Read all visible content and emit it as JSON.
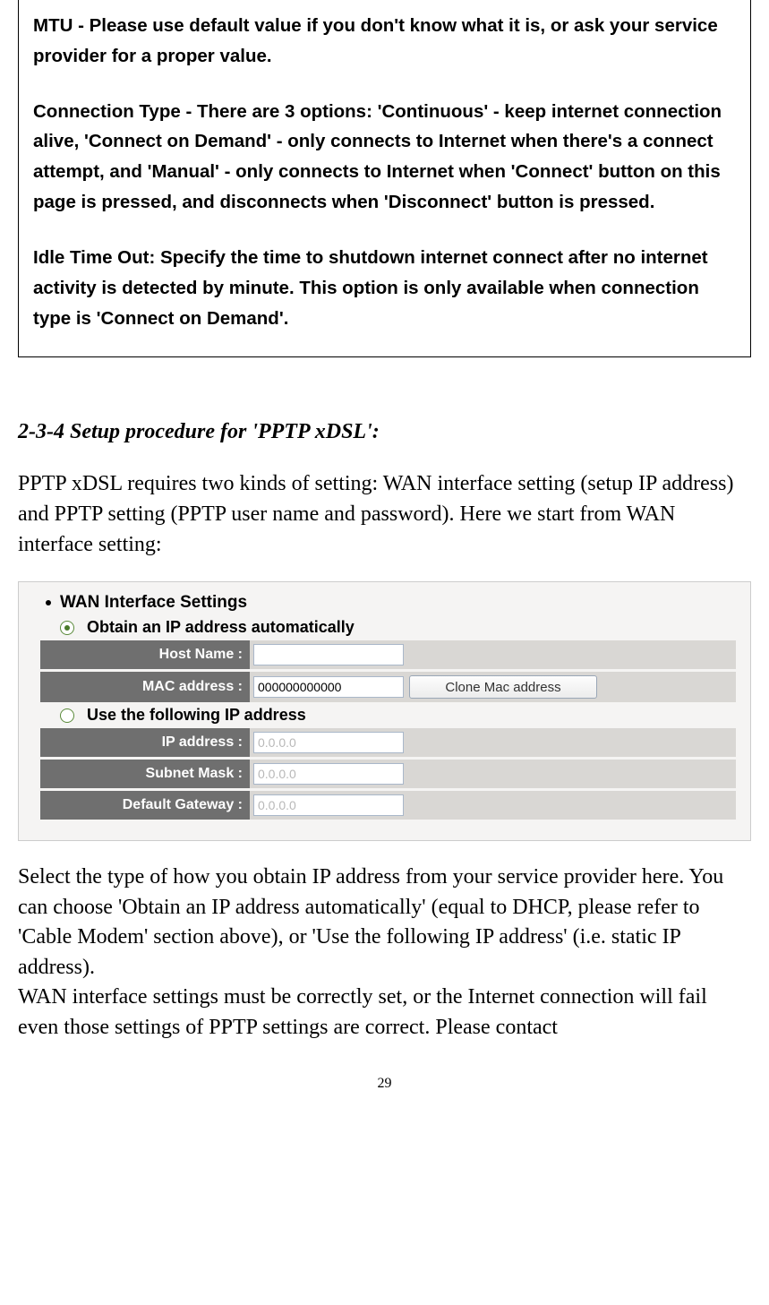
{
  "info_box": {
    "p1": "MTU - Please use default value if you don't know what it is, or ask your service provider for a proper value.",
    "p2": "Connection Type - There are 3 options: 'Continuous' - keep internet connection alive, 'Connect on Demand' - only connects to Internet when there's a connect attempt, and 'Manual' - only connects to Internet when 'Connect' button on this page is pressed, and disconnects when 'Disconnect' button is pressed.",
    "p3": "Idle Time Out: Specify the time to shutdown internet connect after no internet activity is detected by minute. This option is only available when connection type is 'Connect on Demand'."
  },
  "section_heading": "2-3-4 Setup procedure for 'PPTP xDSL':",
  "intro_text": "PPTP xDSL requires two kinds of setting: WAN interface setting (setup IP address) and PPTP setting (PPTP user name and password). Here we start from WAN interface setting:",
  "wan": {
    "title": "WAN Interface Settings",
    "option_auto": "Obtain an IP address automatically",
    "option_static": "Use the following IP address",
    "fields": {
      "host_name": {
        "label": "Host Name :",
        "value": ""
      },
      "mac": {
        "label": "MAC address :",
        "value": "000000000000"
      },
      "ip": {
        "label": "IP address :",
        "value": "0.0.0.0"
      },
      "subnet": {
        "label": "Subnet Mask :",
        "value": "0.0.0.0"
      },
      "gateway": {
        "label": "Default Gateway :",
        "value": "0.0.0.0"
      }
    },
    "clone_button": "Clone Mac address"
  },
  "after_text": "Select the type of how you obtain IP address from your service provider here. You can choose 'Obtain an IP address automatically' (equal to DHCP, please refer to 'Cable Modem' section above), or 'Use the following IP address' (i.e. static IP address).\nWAN interface settings must be correctly set, or the Internet connection will fail even those settings of PPTP settings are correct. Please contact",
  "page_number": "29"
}
